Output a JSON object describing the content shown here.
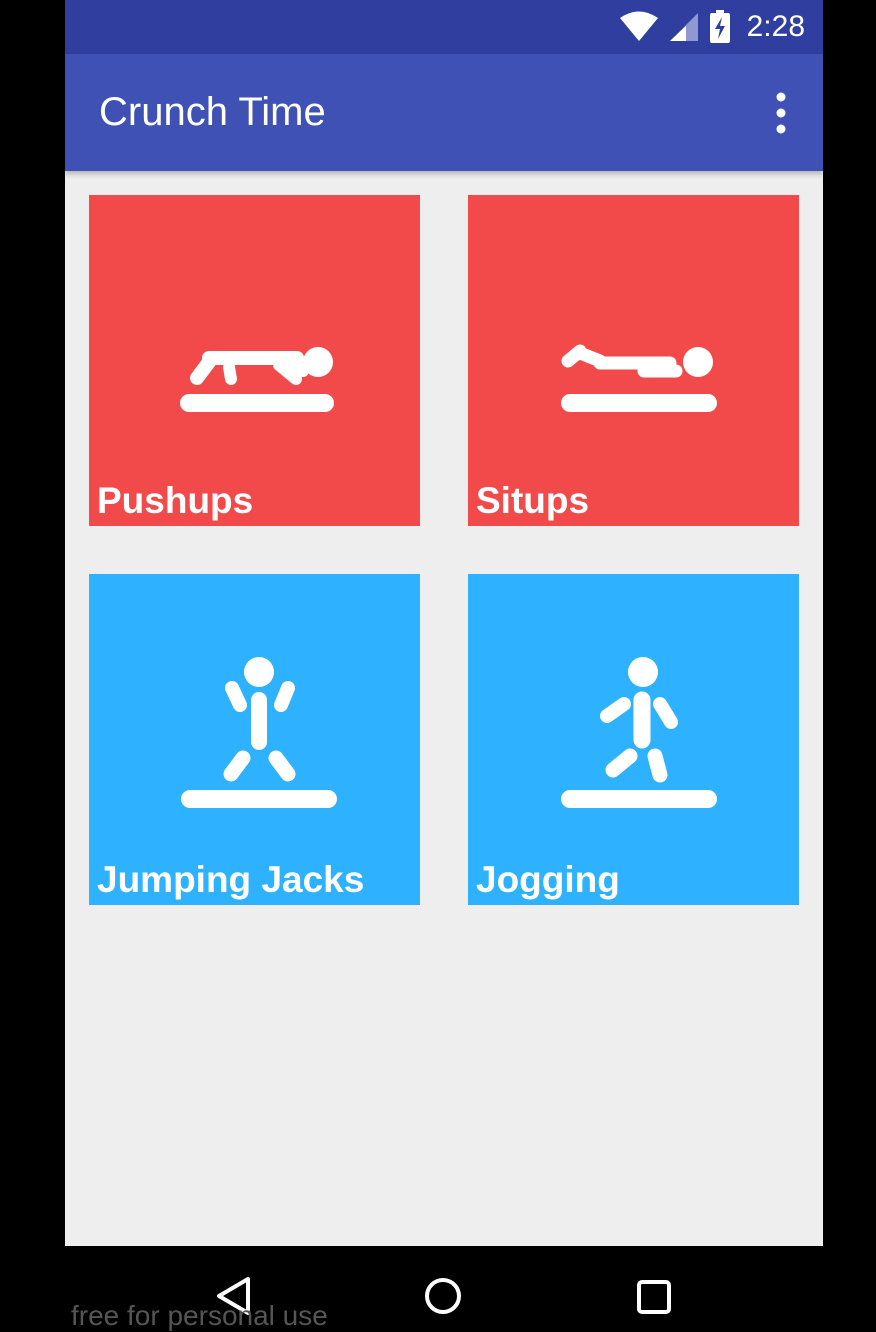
{
  "status_bar": {
    "time": "2:28",
    "icons": [
      "wifi-icon",
      "cell-signal-icon",
      "battery-charging-icon"
    ]
  },
  "app_bar": {
    "title": "Crunch Time",
    "menu_icon": "more-vert-icon"
  },
  "exercises": [
    {
      "label": "Pushups",
      "icon": "pushups-icon",
      "color": "#f24a4a"
    },
    {
      "label": "Situps",
      "icon": "situps-icon",
      "color": "#f24a4a"
    },
    {
      "label": "Jumping Jacks",
      "icon": "jumping-jacks-icon",
      "color": "#2eb2ff"
    },
    {
      "label": "Jogging",
      "icon": "jogging-icon",
      "color": "#2eb2ff"
    }
  ],
  "nav_bar": {
    "buttons": [
      "back-icon",
      "home-icon",
      "recents-icon"
    ]
  },
  "watermark": "free for personal use",
  "colors": {
    "status_bar": "#303f9f",
    "app_bar": "#3f51b5",
    "background": "#eeeeee"
  }
}
